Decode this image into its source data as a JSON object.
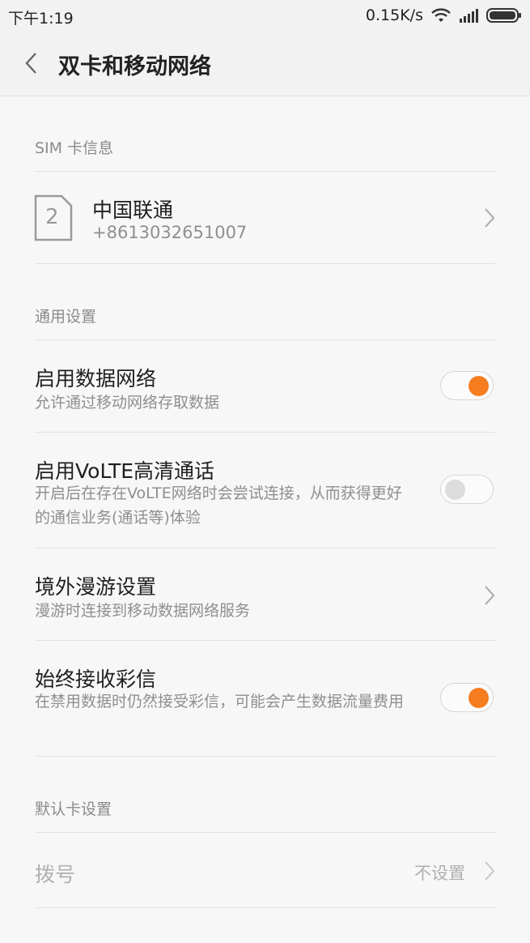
{
  "status_bar": {
    "time": "下午1:19",
    "net_speed": "0.15K/s",
    "icons": [
      "wifi-icon",
      "signal-icon",
      "battery-icon"
    ]
  },
  "header": {
    "back_icon": "chevron-left-icon",
    "title": "双卡和移动网络"
  },
  "sim_section": {
    "label": "SIM 卡信息",
    "sim": {
      "slot_number": "2",
      "carrier": "中国联通",
      "phone_number": "+8613032651007"
    }
  },
  "general_section": {
    "label": "通用设置",
    "items": [
      {
        "title": "启用数据网络",
        "subtitle": "允许通过移动网络存取数据",
        "control": "toggle",
        "on": true
      },
      {
        "title": "启用VoLTE高清通话",
        "subtitle": "开启后在存在VoLTE网络时会尝试连接，从而获得更好的通信业务(通话等)体验",
        "control": "toggle",
        "on": false
      },
      {
        "title": "境外漫游设置",
        "subtitle": "漫游时连接到移动数据网络服务",
        "control": "chevron"
      },
      {
        "title": "始终接收彩信",
        "subtitle": "在禁用数据时仍然接受彩信，可能会产生数据流量费用",
        "control": "toggle",
        "on": true
      }
    ]
  },
  "default_card_section": {
    "label": "默认卡设置",
    "dial": {
      "label": "拨号",
      "value": "不设置"
    }
  },
  "colors": {
    "accent": "#f57c1f",
    "background": "#f7f7f7",
    "secondary_text": "#8f8f8f"
  }
}
